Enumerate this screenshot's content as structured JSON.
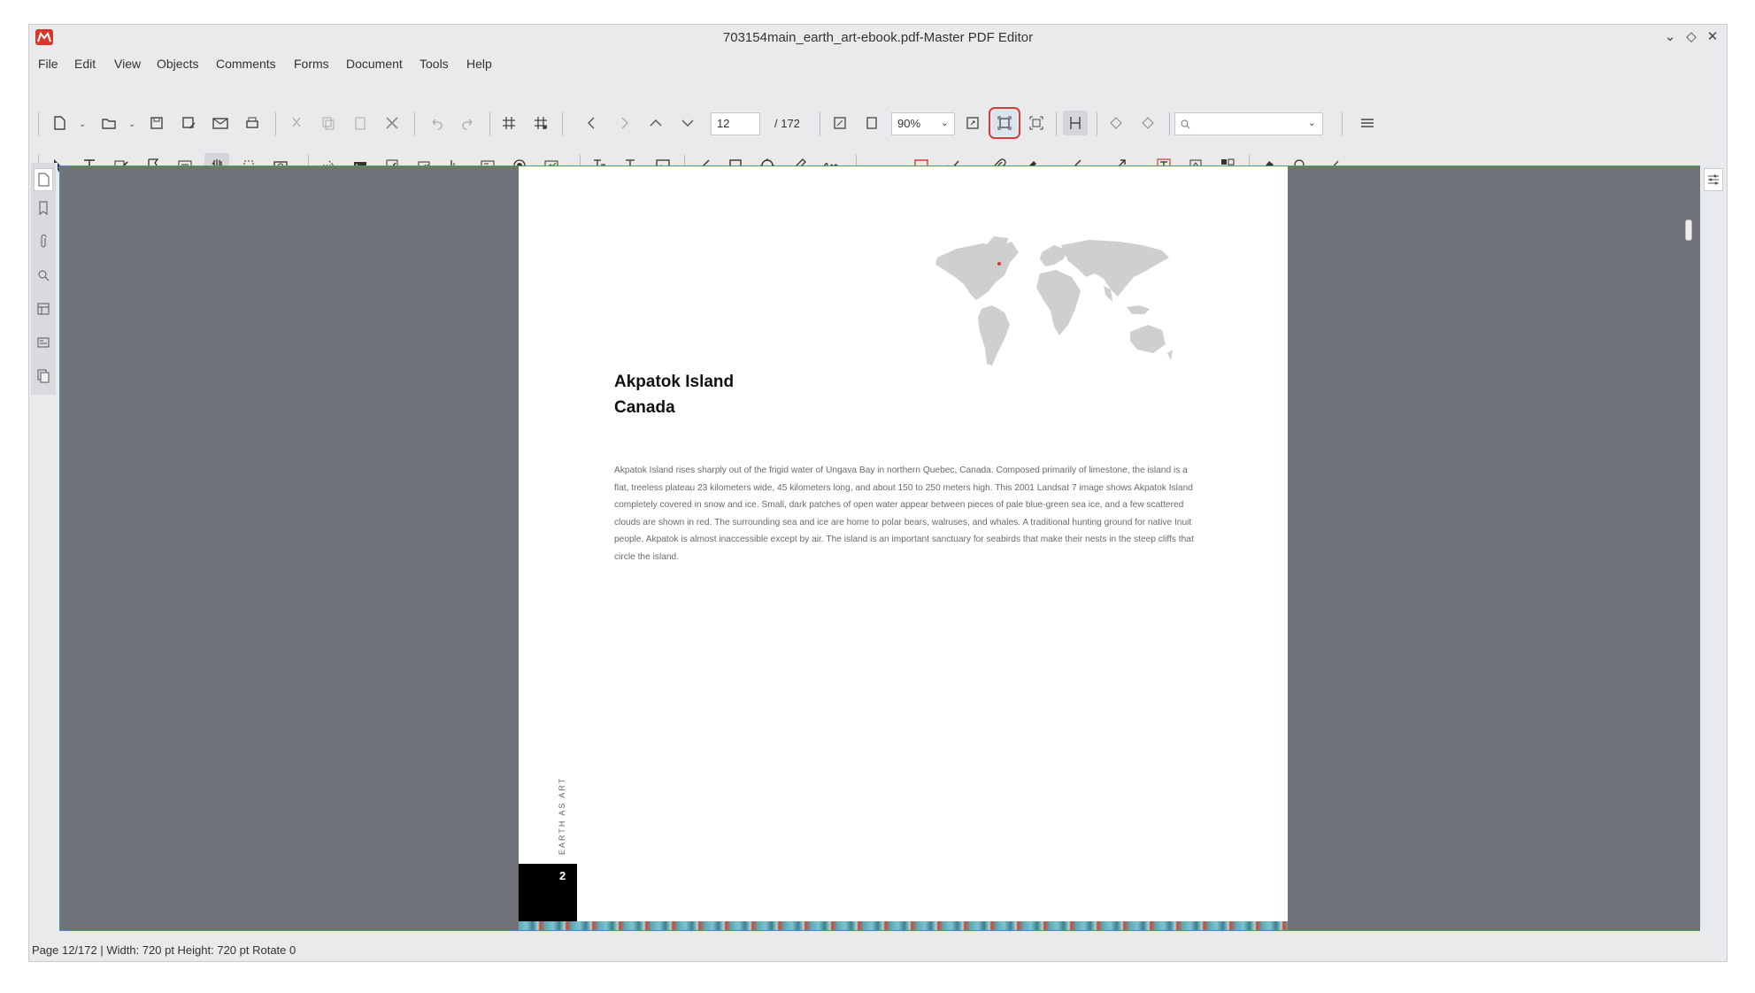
{
  "window": {
    "title": "703154main_earth_art-ebook.pdf-Master PDF Editor"
  },
  "menu": [
    "File",
    "Edit",
    "View",
    "Objects",
    "Comments",
    "Forms",
    "Document",
    "Tools",
    "Help"
  ],
  "navigation": {
    "current_page": "12",
    "total_pages": "/ 172",
    "zoom": "90%",
    "search_placeholder": ""
  },
  "document_page": {
    "title_line1": "Akpatok Island",
    "title_line2": "Canada",
    "body": "Akpatok Island rises sharply out of the frigid water of Ungava Bay in northern Quebec, Canada. Composed primarily of limestone, the island is a flat, treeless plateau 23 kilometers wide, 45 kilometers long, and about 150 to 250 meters high. This 2001 Landsat 7 image shows Akpatok Island completely covered in snow and ice. Small, dark patches of open water appear between pieces of pale blue-green sea ice, and a few scattered clouds are shown in red. The surrounding sea and ice are home to polar bears, walruses, and whales. A traditional hunting ground for native Inuit people, Akpatok is almost inaccessible except by air. The island is an important sanctuary for seabirds that make their nests in the steep cliffs that circle the island.",
    "side_label": "EARTH AS ART",
    "page_number": "2"
  },
  "status": {
    "text": "Page 12/172 | Width: 720 pt Height: 720 pt Rotate 0"
  },
  "colors": {
    "highlight_outline": "#d93a3a",
    "viewer_background": "#6f7278",
    "app_icon": "#d9372e"
  }
}
